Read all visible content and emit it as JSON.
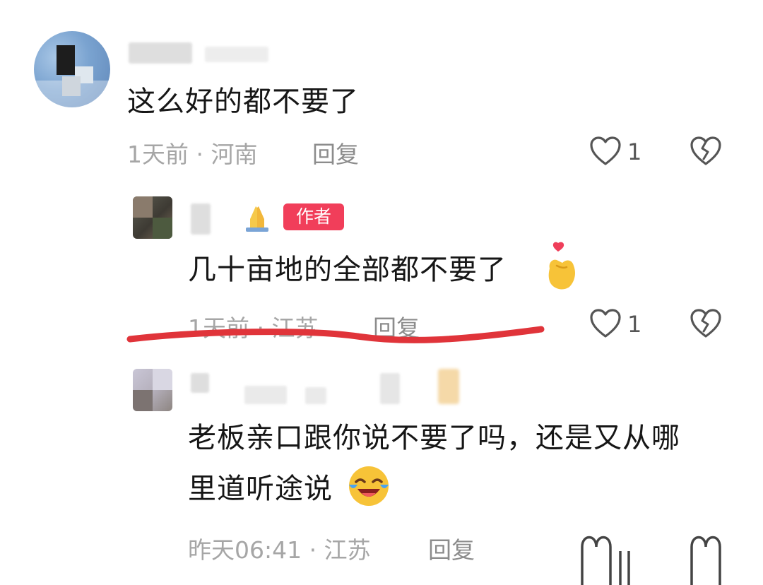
{
  "comments": [
    {
      "text": "这么好的都不要了",
      "meta": "1天前 · 河南",
      "reply_label": "回复",
      "like_count": "1"
    },
    {
      "badge": "作者",
      "text": "几十亩地的全部都不要了",
      "meta": "1天前 · 江苏",
      "reply_label": "回复",
      "like_count": "1"
    },
    {
      "text_line1": "老板亲口跟你说不要了吗，还是又从哪",
      "text_line2": "里道听途说",
      "meta": "昨天06:41 · 江苏",
      "reply_label": "回复"
    }
  ],
  "colors": {
    "badge_bg": "#f13e5a",
    "underline": "#e0343a",
    "meta_text": "#a6a6a6",
    "comment_text": "#161616"
  },
  "icons": [
    "heart-outline-icon",
    "broken-heart-icon",
    "heart-hands-emoji",
    "laughing-tears-emoji",
    "folded-hands-emoji"
  ]
}
